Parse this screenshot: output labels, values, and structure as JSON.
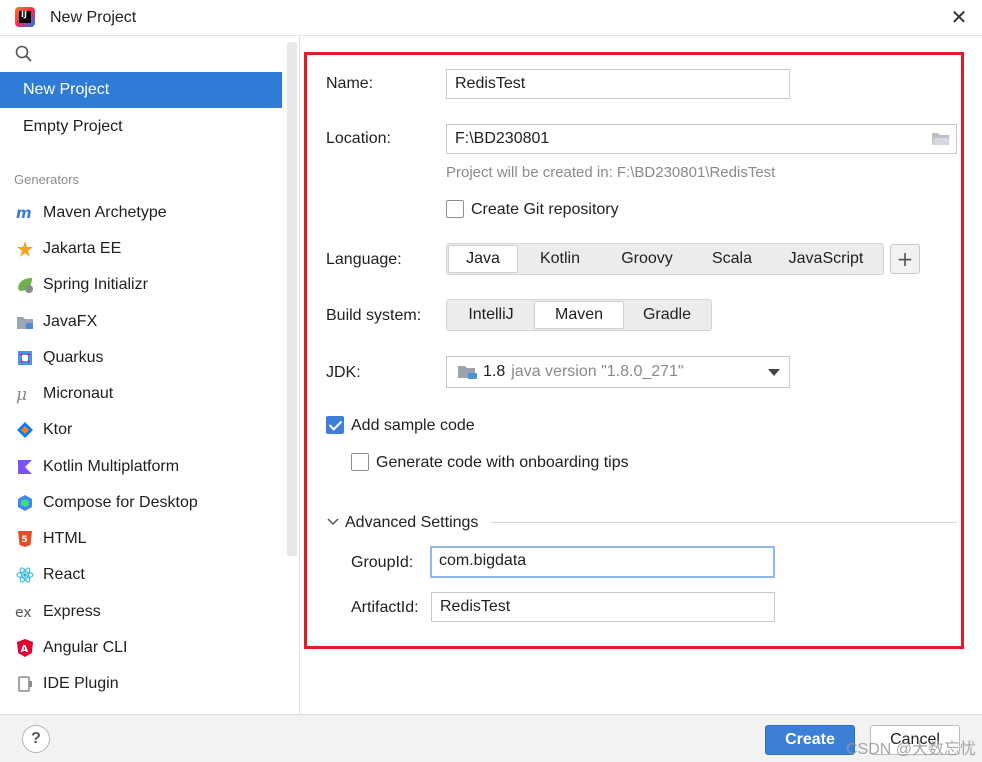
{
  "window": {
    "title": "New Project"
  },
  "sidebar": {
    "items": [
      {
        "label": "New Project"
      },
      {
        "label": "Empty Project"
      }
    ],
    "section_label": "Generators",
    "generators": [
      {
        "label": "Maven Archetype",
        "icon": "maven-icon"
      },
      {
        "label": "Jakarta EE",
        "icon": "jakarta-ee-icon"
      },
      {
        "label": "Spring Initializr",
        "icon": "spring-icon"
      },
      {
        "label": "JavaFX",
        "icon": "javafx-icon"
      },
      {
        "label": "Quarkus",
        "icon": "quarkus-icon"
      },
      {
        "label": "Micronaut",
        "icon": "micronaut-icon"
      },
      {
        "label": "Ktor",
        "icon": "ktor-icon"
      },
      {
        "label": "Kotlin Multiplatform",
        "icon": "kotlin-icon"
      },
      {
        "label": "Compose for Desktop",
        "icon": "compose-icon"
      },
      {
        "label": "HTML",
        "icon": "html5-icon"
      },
      {
        "label": "React",
        "icon": "react-icon"
      },
      {
        "label": "Express",
        "icon": "express-icon"
      },
      {
        "label": "Angular CLI",
        "icon": "angular-icon"
      },
      {
        "label": "IDE Plugin",
        "icon": "plugin-icon"
      }
    ]
  },
  "form": {
    "name_label": "Name:",
    "name_value": "RedisTest",
    "location_label": "Location:",
    "location_value": "F:\\BD230801",
    "location_hint": "Project will be created in: F:\\BD230801\\RedisTest",
    "git_label": "Create Git repository",
    "language_label": "Language:",
    "languages": [
      "Java",
      "Kotlin",
      "Groovy",
      "Scala",
      "JavaScript"
    ],
    "build_label": "Build system:",
    "build_systems": [
      "IntelliJ",
      "Maven",
      "Gradle"
    ],
    "jdk_label": "JDK:",
    "jdk_version": "1.8",
    "jdk_detail": "java version \"1.8.0_271\"",
    "sample_code_label": "Add sample code",
    "onboarding_label": "Generate code with onboarding tips",
    "advanced_label": "Advanced Settings",
    "groupid_label": "GroupId:",
    "groupid_value": "com.bigdata",
    "artifactid_label": "ArtifactId:",
    "artifactid_value": "RedisTest"
  },
  "footer": {
    "help_label": "?",
    "create_label": "Create",
    "cancel_label": "Cancel",
    "watermark": "CSDN @大数忘忧"
  },
  "colors": {
    "accent": "#2f7bd6",
    "highlight_border": "#e11d2a"
  }
}
